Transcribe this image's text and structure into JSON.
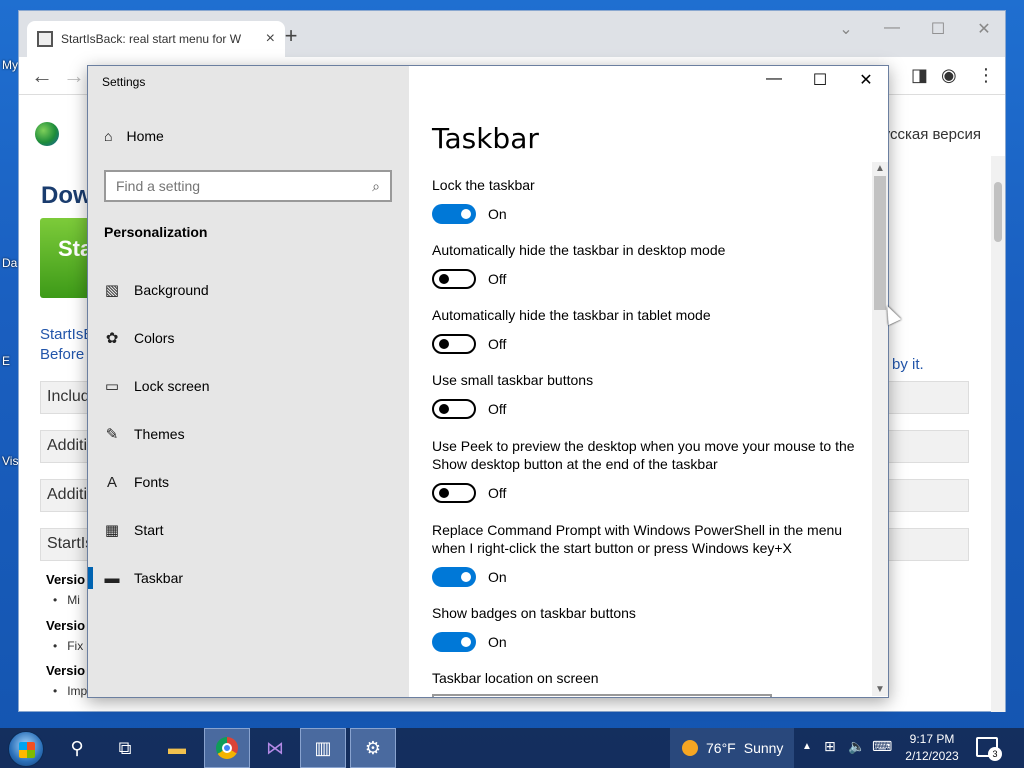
{
  "desktop": {
    "labels": [
      "My",
      "Da",
      "E",
      "Vis"
    ]
  },
  "browser": {
    "tab_title": "StartIsBack: real start menu for W",
    "tab_close": "×",
    "new_tab": "+",
    "russian_link": "Русская версия",
    "heading": "Dow",
    "green_button": "Sta",
    "para1": "StartIsB",
    "para2": "Before",
    "para_tail": "by it.",
    "rows": [
      "Includ",
      "Additi",
      "Additi",
      "StartIsB"
    ],
    "versions": [
      "Versio",
      "Versio",
      "Versio"
    ],
    "bullets": [
      "Mi",
      "Fix",
      "Imp"
    ]
  },
  "settings": {
    "window_title": "Settings",
    "home_label": "Home",
    "search_placeholder": "Find a setting",
    "section_title": "Personalization",
    "nav": [
      {
        "label": "Background",
        "icon": "picture-icon"
      },
      {
        "label": "Colors",
        "icon": "palette-icon"
      },
      {
        "label": "Lock screen",
        "icon": "lock-screen-icon"
      },
      {
        "label": "Themes",
        "icon": "themes-icon"
      },
      {
        "label": "Fonts",
        "icon": "fonts-icon"
      },
      {
        "label": "Start",
        "icon": "start-icon"
      },
      {
        "label": "Taskbar",
        "icon": "taskbar-icon",
        "active": true
      }
    ],
    "page_title": "Taskbar",
    "options": [
      {
        "label": "Lock the taskbar",
        "state": "On"
      },
      {
        "label": "Automatically hide the taskbar in desktop mode",
        "state": "Off"
      },
      {
        "label": "Automatically hide the taskbar in tablet mode",
        "state": "Off"
      },
      {
        "label": "Use small taskbar buttons",
        "state": "Off"
      },
      {
        "label": "Use Peek to preview the desktop when you move your mouse to the Show desktop button at the end of the taskbar",
        "state": "Off"
      },
      {
        "label": "Replace Command Prompt with Windows PowerShell in the menu when I right-click the start button or press Windows key+X",
        "state": "On"
      },
      {
        "label": "Show badges on taskbar buttons",
        "state": "On"
      }
    ],
    "location_label": "Taskbar location on screen"
  },
  "taskbar": {
    "weather_temp": "76°F",
    "weather_desc": "Sunny",
    "time": "9:17 PM",
    "date": "2/12/2023",
    "notification_count": "3"
  },
  "colors": {
    "accent": "#0078d7",
    "sidebar_bg": "#e6e6e6"
  }
}
